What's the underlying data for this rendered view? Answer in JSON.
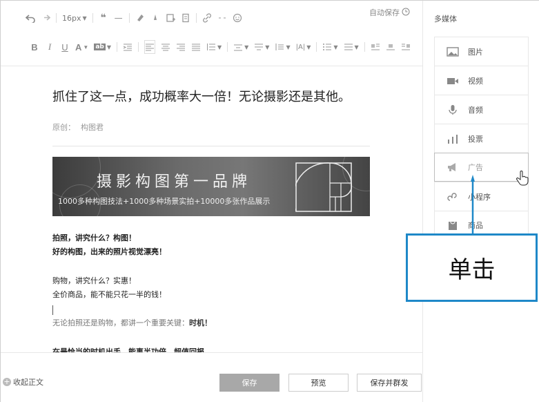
{
  "toolbar": {
    "font_size": "16px",
    "autosave": "自动保存",
    "row2": {
      "bold": "B",
      "italic": "I",
      "underline": "U",
      "font_color": "A",
      "bg_color": "ab"
    }
  },
  "article": {
    "title": "抓住了这一点，成功概率大一倍！无论摄影还是其他。",
    "author_label": "原创：",
    "author_name": "构图君",
    "banner_title": "摄影构图第一品牌",
    "banner_sub": "1000多种构图技法+1000多种场景实拍+10000多张作品展示",
    "paragraphs": [
      "拍照，讲究什么？构图！",
      "好的构图，出来的照片视觉漂亮！",
      "购物，讲究什么？实惠！",
      "全价商品，能不能只花一半的钱！",
      "无论拍照还是购物，都讲一个重要关键：",
      "时机！",
      "在最恰当的时机出手，能事半功倍，超值回报"
    ]
  },
  "footer": {
    "collapse": "收起正文",
    "save": "保存",
    "preview": "预览",
    "publish": "保存并群发"
  },
  "sidebar": {
    "title": "多媒体",
    "items": [
      {
        "label": "图片",
        "icon": "image-icon"
      },
      {
        "label": "视频",
        "icon": "video-icon"
      },
      {
        "label": "音频",
        "icon": "microphone-icon"
      },
      {
        "label": "投票",
        "icon": "poll-icon"
      },
      {
        "label": "广告",
        "icon": "megaphone-icon"
      },
      {
        "label": "小程序",
        "icon": "mini-program-icon"
      },
      {
        "label": "商品",
        "icon": "product-icon"
      }
    ]
  },
  "annotation": {
    "text": "单击",
    "color": "#1e88c8"
  }
}
